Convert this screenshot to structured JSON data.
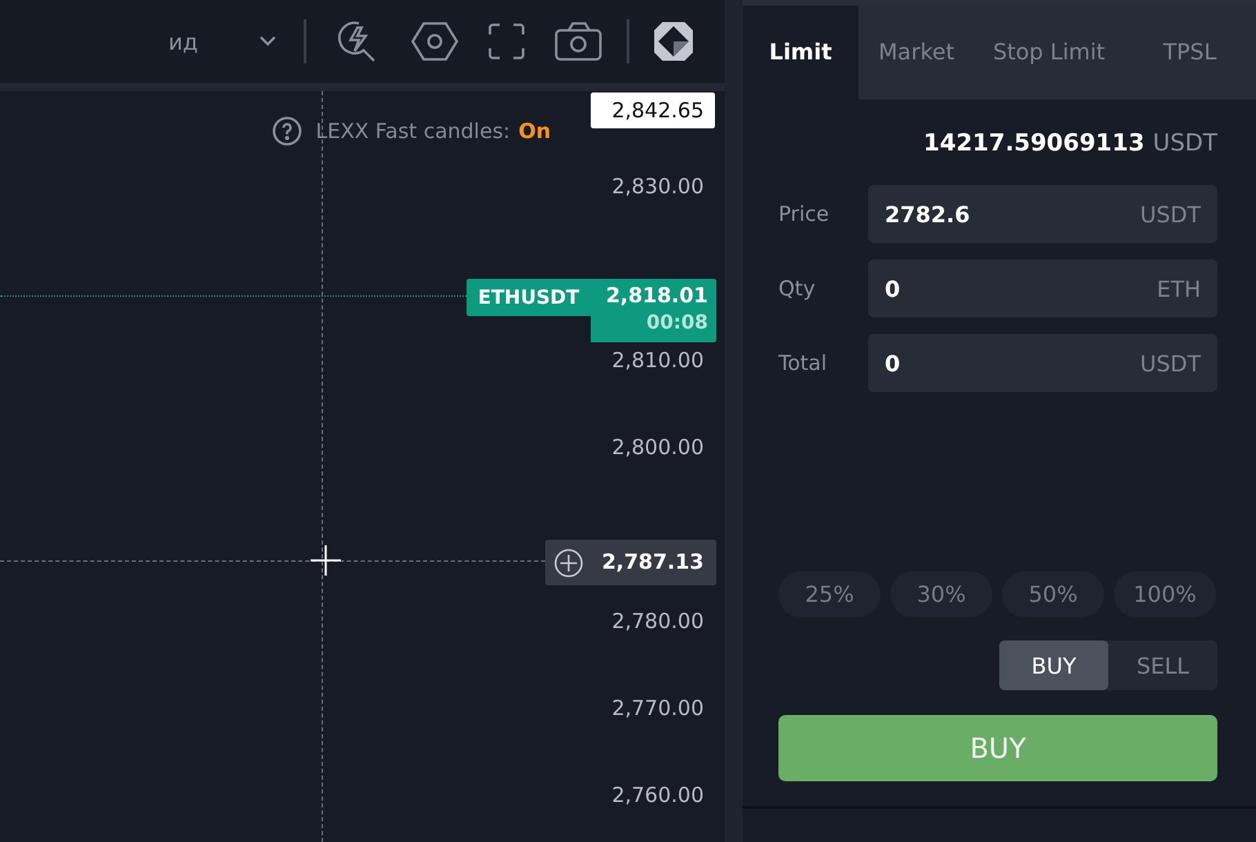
{
  "toolbar": {
    "interval_label": "ид"
  },
  "chart": {
    "notice": {
      "text": "LEXX Fast candles:",
      "state": "On",
      "on": true
    },
    "high_price": "2,842.65",
    "price_axis": [
      "2,830.00",
      "2,810.00",
      "2,800.00",
      "2,780.00",
      "2,770.00",
      "2,760.00"
    ],
    "last_price": {
      "symbol": "ETHUSDT",
      "price": "2,818.01",
      "countdown": "00:08"
    },
    "crosshair_price": "2,787.13"
  },
  "order_panel": {
    "tabs": [
      {
        "label": "Limit",
        "selected": true
      },
      {
        "label": "Market",
        "selected": false
      },
      {
        "label": "Stop Limit",
        "selected": false
      },
      {
        "label": "TPSL",
        "selected": false
      }
    ],
    "balance": {
      "amount": "14217.59069113",
      "currency": "USDT"
    },
    "fields": [
      {
        "label": "Price",
        "value": "2782.6",
        "unit": "USDT"
      },
      {
        "label": "Qty",
        "value": "0",
        "unit": "ETH"
      },
      {
        "label": "Total",
        "value": "0",
        "unit": "USDT"
      }
    ],
    "percent_buttons": [
      "25%",
      "30%",
      "50%",
      "100%"
    ],
    "side_toggle": [
      {
        "label": "BUY",
        "selected": true
      },
      {
        "label": "SELL",
        "selected": false
      }
    ],
    "submit_button": "BUY"
  }
}
